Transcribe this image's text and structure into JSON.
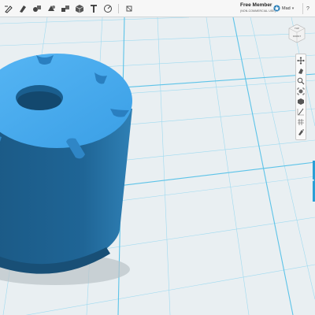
{
  "topbar": {
    "icons": [
      "sketch-tool-icon",
      "modify-tool-icon",
      "primitives-icon",
      "construct-icon",
      "boxes-icon",
      "cube-icon",
      "text-icon",
      "measure-icon",
      "material-icon"
    ],
    "member_name": "Free Member",
    "member_sub": "(NON-COMMERCIAL USE)",
    "user_name": "Mad",
    "help_label": "?"
  },
  "viewcube": {
    "top_label": "TOP",
    "front_label": "FRONT"
  },
  "right_toolbar": {
    "icons": [
      "pan-icon",
      "orbit-icon",
      "zoom-icon",
      "fit-icon",
      "view-icon",
      "perspective-icon",
      "grid-icon",
      "snap-icon"
    ]
  },
  "colors": {
    "model_top": "#45a9ee",
    "model_side": "#1e5f8c",
    "grid_line": "#8fd3ec",
    "background": "#e8eef1",
    "accent": "#2a9fd6"
  }
}
